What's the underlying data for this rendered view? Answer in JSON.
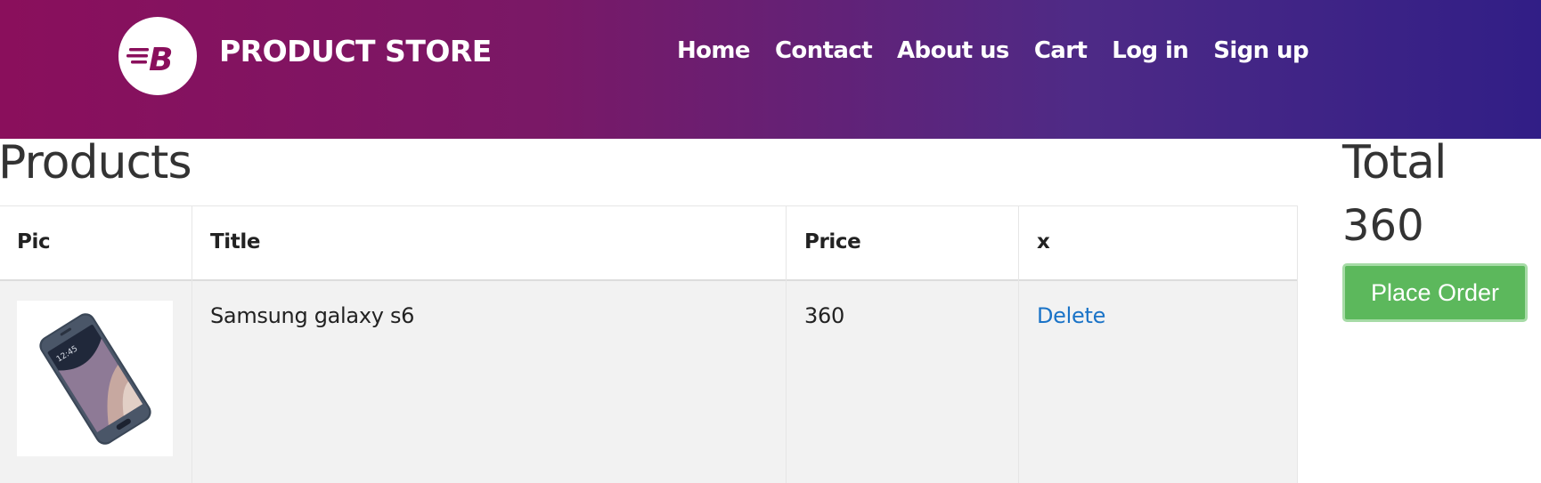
{
  "header": {
    "brand": "PRODUCT STORE",
    "logo_icon": "brand-b-logo-icon",
    "nav": [
      {
        "label": "Home"
      },
      {
        "label": "Contact"
      },
      {
        "label": "About us"
      },
      {
        "label": "Cart"
      },
      {
        "label": "Log in"
      },
      {
        "label": "Sign up"
      }
    ],
    "colors": {
      "gradient_start": "#8a0f5c",
      "gradient_end": "#311e86"
    }
  },
  "products": {
    "title": "Products",
    "columns": [
      "Pic",
      "Title",
      "Price",
      "x"
    ],
    "rows": [
      {
        "pic": "samsung-galaxy-s6-image",
        "title": "Samsung galaxy s6",
        "price": "360",
        "action": "Delete"
      }
    ]
  },
  "summary": {
    "total_label": "Total",
    "total_value": "360",
    "place_order_label": "Place Order",
    "button_color": "#5cb85c"
  }
}
